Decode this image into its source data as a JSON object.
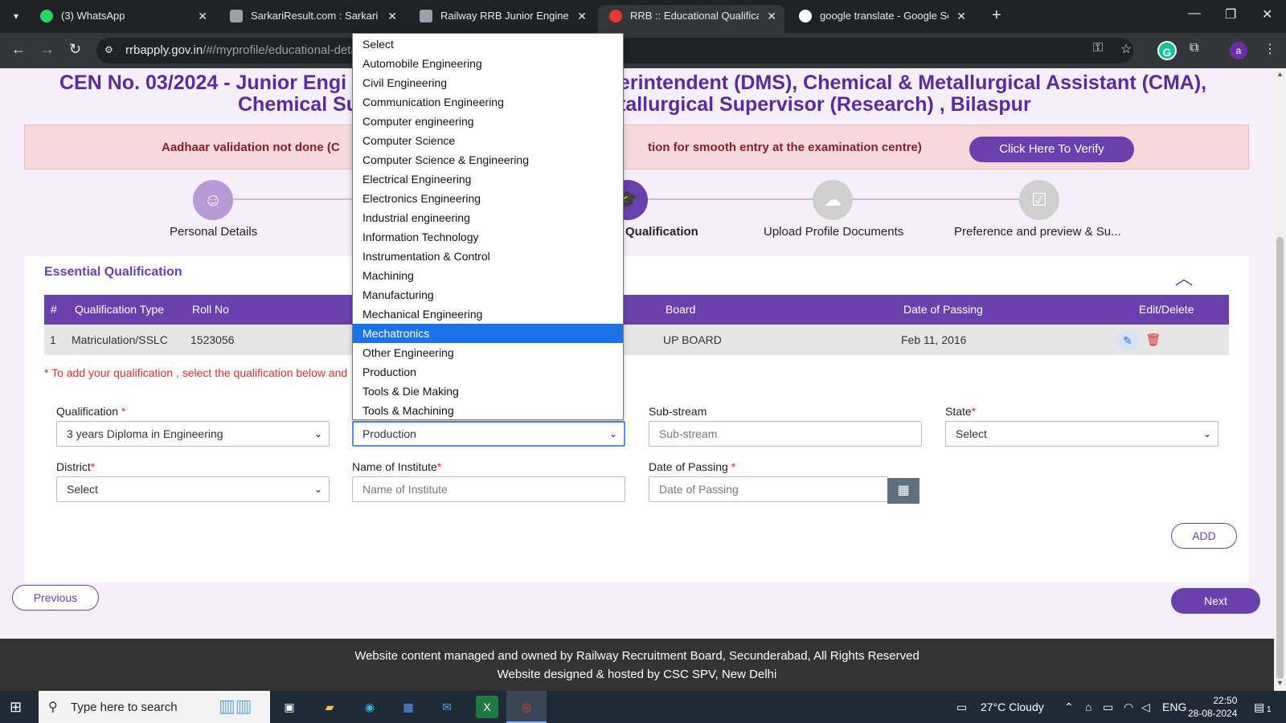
{
  "browser": {
    "tabs": [
      {
        "label": "(3) WhatsApp",
        "active": false
      },
      {
        "label": "SarkariResult.com : Sarkari Resu",
        "active": false
      },
      {
        "label": "Railway RRB Junior Engineer JE",
        "active": false
      },
      {
        "label": "RRB :: Educational Qualification",
        "active": true
      },
      {
        "label": "google translate - Google Searc",
        "active": false
      }
    ],
    "url_host": "rrbapply.gov.in",
    "url_path": "/#/myprofile/educational-deta",
    "profile_letter": "a",
    "grammarly_letter": "G"
  },
  "page": {
    "headline_line1": "CEN No. 03/2024 - Junior Engi",
    "headline_line1b": "erintendent (DMS), Chemical & Metallurgical Assistant (CMA),",
    "headline_line2": "Chemical Su",
    "headline_line2b": "tallurgical Supervisor (Research) , Bilaspur",
    "aadhaar_text_left": "Aadhaar validation not done (C",
    "aadhaar_text_right": "tion for smooth entry at the examination centre)",
    "verify_button": "Click Here To Verify",
    "steps": [
      {
        "label": "Personal Details",
        "icon": "person-icon"
      },
      {
        "label": "Qualification",
        "icon": "graduation-cap-icon"
      },
      {
        "label": "Upload Profile Documents",
        "icon": "cloud-upload-icon"
      },
      {
        "label": "Preference and preview & Su...",
        "icon": "clipboard-check-icon"
      }
    ]
  },
  "card": {
    "title": "Essential Qualification",
    "table": {
      "headers": [
        "#",
        "Qualification Type",
        "Roll No",
        "Board",
        "Date of Passing",
        "Edit/Delete"
      ],
      "rows": [
        {
          "num": "1",
          "type": "Matriculation/SSLC",
          "roll": "1523056",
          "board": "UP BOARD",
          "date": "Feb 11, 2016"
        }
      ]
    },
    "note": "* To add your qualification , select the qualification below and",
    "form": {
      "qualification_label": "Qualification",
      "qualification_value": "3 years Diploma in Engineering",
      "stream_value": "Production",
      "substream_label": "Sub-stream",
      "substream_placeholder": "Sub-stream",
      "state_label": "State",
      "state_value": "Select",
      "district_label": "District",
      "district_value": "Select",
      "institute_label": "Name of Institute",
      "institute_placeholder": "Name of Institute",
      "date_label": "Date of Passing",
      "date_placeholder": "Date of Passing",
      "required_mark": "*"
    },
    "add_button": "ADD"
  },
  "nav": {
    "previous": "Previous",
    "next": "Next"
  },
  "footer": {
    "line1": "Website content managed and owned by Railway Recruitment Board, Secunderabad, All Rights Reserved",
    "line2": "Website designed & hosted by CSC SPV, New Delhi"
  },
  "dropdown": {
    "options": [
      "Select",
      "Automobile Engineering",
      "Civil Engineering",
      "Communication Engineering",
      "Computer engineering",
      "Computer Science",
      "Computer Science & Engineering",
      "Electrical Engineering",
      "Electronics Engineering",
      "Industrial engineering",
      "Information Technology",
      "Instrumentation & Control",
      "Machining",
      "Manufacturing",
      "Mechanical Engineering",
      "Mechatronics",
      "Other Engineering",
      "Production",
      "Tools & Die Making",
      "Tools & Machining"
    ],
    "highlighted": "Mechatronics"
  },
  "taskbar": {
    "search_text": "Type here to search",
    "weather": "27°C  Cloudy",
    "language": "ENG",
    "time": "22:50",
    "date": "28-08-2024",
    "notification_count": "1"
  },
  "colors": {
    "accent": "#6a3fae",
    "highlight": "#1a73e8",
    "alert_text": "#8a1d2a"
  }
}
